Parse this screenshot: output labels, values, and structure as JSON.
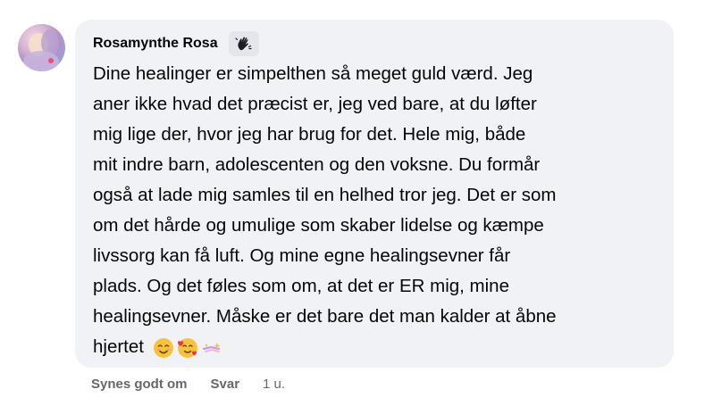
{
  "comment": {
    "author": "Rosamynthe Rosa",
    "badge_icon": "waving-hand-icon",
    "text_lines": [
      "Dine healinger er simpelthen så meget guld værd. Jeg",
      "aner ikke hvad det præcist er, jeg ved bare, at du løfter",
      "mig lige der, hvor jeg har brug for det. Hele mig, både",
      "mit indre barn, adolescenten og den voksne. Du formår",
      "også at lade mig samles til en helhed tror jeg. Det er som",
      "om det hårde og umulige som skaber lidelse og kæmpe",
      "livssorg kan få luft. Og mine egne healingsevner får",
      "plads. Og det føles som om, at det er ER mig, mine",
      "healingsevner. Måske er det bare det man kalder at åbne",
      "hjertet"
    ],
    "emojis": [
      "smiling-face-emoji",
      "face-with-hearts-emoji",
      "sparkles-emoji"
    ]
  },
  "actions": {
    "like_label": "Synes godt om",
    "reply_label": "Svar",
    "timestamp": "1 u."
  },
  "colors": {
    "bubble_bg": "#f0f2f5",
    "secondary_text": "#65676b",
    "primary_text": "#050505"
  }
}
